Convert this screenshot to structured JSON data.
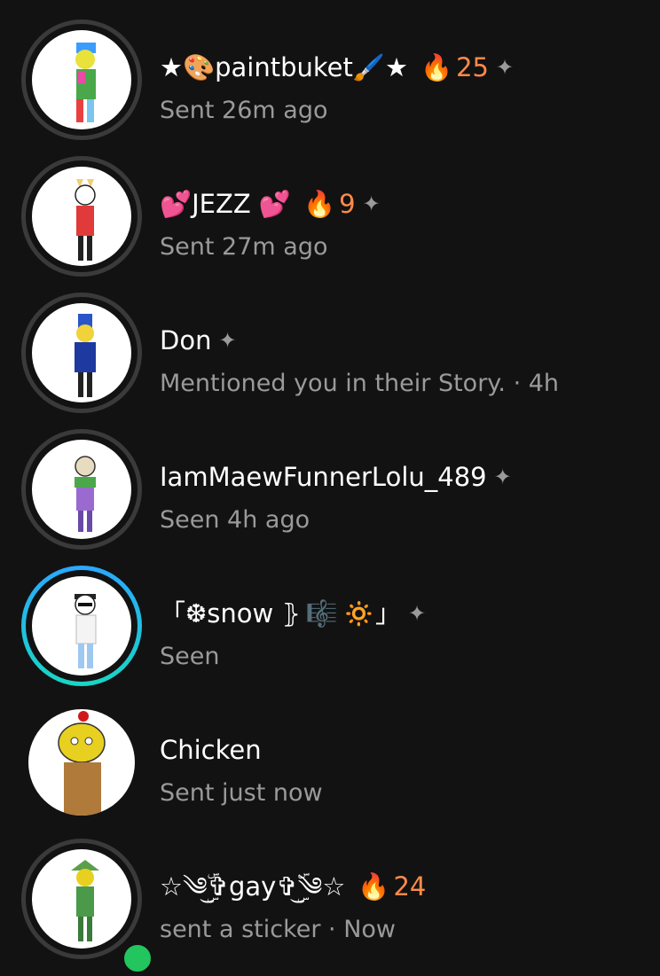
{
  "chats": [
    {
      "name": "★🎨paintbuket🖌️★",
      "streak": "25",
      "status": "Sent 26m ago",
      "pinned": true
    },
    {
      "name": "💕JEZZ 💕",
      "streak": "9",
      "status": "Sent 27m ago",
      "pinned": true
    },
    {
      "name": "Don",
      "streak": "",
      "status": "Mentioned you in their Story. · 4h",
      "pinned": true
    },
    {
      "name": "IamMaewFunnerLolu_489",
      "streak": "",
      "status": "Seen 4h ago",
      "pinned": true
    },
    {
      "name": "「❆snow ⦄",
      "name_suffix": "🔅」",
      "streak": "",
      "status": "Seen",
      "pinned": true
    },
    {
      "name": "Chicken",
      "streak": "",
      "status": "Sent just now",
      "pinned": false
    },
    {
      "name": "☆༄ۣۜ͜✞gay✞ۣۜ͜༄☆",
      "streak": "24",
      "status": "sent a sticker · Now",
      "pinned": false
    }
  ],
  "icons": {
    "fire": "🔥",
    "pin": "✦",
    "music": "🎼"
  },
  "colors": {
    "background": "#121212",
    "streak": "#ff8a4a",
    "status": "#9a9a9a",
    "story_ring_start": "#2aa8ff",
    "story_ring_end": "#19d6c4",
    "online": "#22c55e"
  }
}
